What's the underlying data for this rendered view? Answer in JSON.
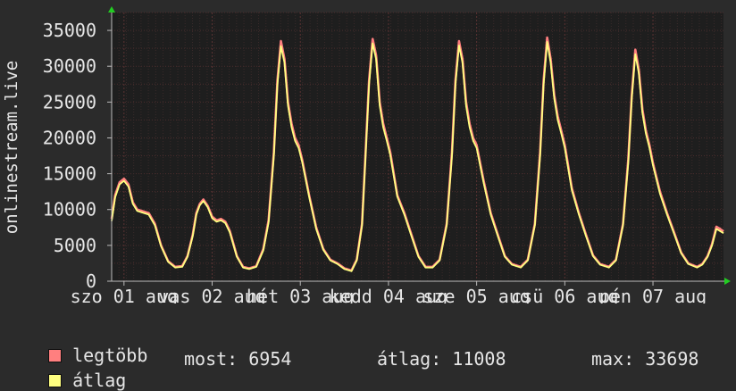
{
  "chart_data": {
    "type": "line",
    "ylabel": "onlinestream.live",
    "ylim": [
      0,
      37500
    ],
    "yticks": [
      "0",
      "5000",
      "10000",
      "15000",
      "20000",
      "25000",
      "30000",
      "35000"
    ],
    "ytick_values": [
      0,
      5000,
      10000,
      15000,
      20000,
      25000,
      30000,
      35000
    ],
    "xlim": [
      0,
      6.8
    ],
    "xticks": [
      "szo 01 aug",
      "vas 02 aug",
      "hét 03 aug",
      "kedd 04 aug",
      "sze 05 aug",
      "csü 06 aug",
      "pén 07 aug"
    ],
    "xtick_values": [
      0,
      1,
      2,
      3,
      4,
      5,
      6
    ],
    "grid": true,
    "legend_position": "bottom-left",
    "series": [
      {
        "name": "legtöbb",
        "color": "#ff7f7f",
        "x": [
          -0.14,
          -0.1,
          -0.05,
          0.0,
          0.05,
          0.1,
          0.15,
          0.2,
          0.28,
          0.35,
          0.42,
          0.5,
          0.58,
          0.66,
          0.72,
          0.78,
          0.82,
          0.86,
          0.9,
          0.95,
          1.0,
          1.05,
          1.1,
          1.15,
          1.2,
          1.28,
          1.35,
          1.42,
          1.5,
          1.58,
          1.64,
          1.7,
          1.74,
          1.78,
          1.82,
          1.86,
          1.9,
          1.94,
          1.98,
          2.02,
          2.1,
          2.18,
          2.26,
          2.34,
          2.42,
          2.5,
          2.58,
          2.64,
          2.7,
          2.74,
          2.78,
          2.82,
          2.86,
          2.9,
          2.94,
          2.98,
          3.02,
          3.1,
          3.18,
          3.26,
          3.34,
          3.42,
          3.5,
          3.58,
          3.66,
          3.72,
          3.76,
          3.8,
          3.84,
          3.88,
          3.92,
          3.96,
          4.0,
          4.08,
          4.16,
          4.24,
          4.32,
          4.4,
          4.5,
          4.58,
          4.66,
          4.72,
          4.76,
          4.8,
          4.84,
          4.88,
          4.92,
          4.96,
          5.0,
          5.08,
          5.16,
          5.24,
          5.32,
          5.4,
          5.5,
          5.58,
          5.66,
          5.72,
          5.76,
          5.8,
          5.84,
          5.88,
          5.92,
          5.96,
          6.0,
          6.08,
          6.16,
          6.24,
          6.32,
          6.4,
          6.5,
          6.56,
          6.62,
          6.67,
          6.72,
          6.76,
          6.8
        ],
        "y": [
          8700,
          12000,
          13800,
          14300,
          13500,
          11000,
          10000,
          9800,
          9500,
          8000,
          5000,
          2800,
          2000,
          2100,
          3500,
          6500,
          9500,
          10800,
          11400,
          10500,
          9000,
          8500,
          8700,
          8300,
          7000,
          3500,
          2000,
          1800,
          2100,
          4500,
          8500,
          18000,
          28000,
          33500,
          31000,
          25000,
          22000,
          20000,
          19000,
          17000,
          12000,
          7500,
          4500,
          3000,
          2500,
          1800,
          1500,
          3000,
          8000,
          18000,
          28000,
          33800,
          31500,
          25000,
          22000,
          20000,
          18000,
          12000,
          9500,
          6500,
          3500,
          2000,
          2000,
          3000,
          8000,
          18000,
          28000,
          33500,
          31000,
          25000,
          22000,
          20000,
          19000,
          14000,
          9500,
          6500,
          3500,
          2400,
          2000,
          3000,
          8000,
          18000,
          28000,
          34000,
          31000,
          26000,
          23000,
          21000,
          19000,
          13000,
          9500,
          6500,
          3600,
          2400,
          2000,
          3000,
          8000,
          17000,
          26000,
          32300,
          29500,
          24000,
          21000,
          19000,
          16500,
          12500,
          9500,
          6800,
          4000,
          2500,
          2000,
          2400,
          3500,
          5200,
          7600,
          7300,
          6954
        ]
      },
      {
        "name": "átlag",
        "color": "#ffff80",
        "x": [
          -0.14,
          -0.1,
          -0.05,
          0.0,
          0.05,
          0.1,
          0.15,
          0.2,
          0.28,
          0.35,
          0.42,
          0.5,
          0.58,
          0.66,
          0.72,
          0.78,
          0.82,
          0.86,
          0.9,
          0.95,
          1.0,
          1.05,
          1.1,
          1.15,
          1.2,
          1.28,
          1.35,
          1.42,
          1.5,
          1.58,
          1.64,
          1.7,
          1.74,
          1.78,
          1.82,
          1.86,
          1.9,
          1.94,
          1.98,
          2.02,
          2.1,
          2.18,
          2.26,
          2.34,
          2.42,
          2.5,
          2.58,
          2.64,
          2.7,
          2.74,
          2.78,
          2.82,
          2.86,
          2.9,
          2.94,
          2.98,
          3.02,
          3.1,
          3.18,
          3.26,
          3.34,
          3.42,
          3.5,
          3.58,
          3.66,
          3.72,
          3.76,
          3.8,
          3.84,
          3.88,
          3.92,
          3.96,
          4.0,
          4.08,
          4.16,
          4.24,
          4.32,
          4.4,
          4.5,
          4.58,
          4.66,
          4.72,
          4.76,
          4.8,
          4.84,
          4.88,
          4.92,
          4.96,
          5.0,
          5.08,
          5.16,
          5.24,
          5.32,
          5.4,
          5.5,
          5.58,
          5.66,
          5.72,
          5.76,
          5.8,
          5.84,
          5.88,
          5.92,
          5.96,
          6.0,
          6.08,
          6.16,
          6.24,
          6.32,
          6.4,
          6.5,
          6.56,
          6.62,
          6.67,
          6.72,
          6.76,
          6.8
        ],
        "y": [
          8400,
          11700,
          13500,
          14000,
          13200,
          10800,
          9800,
          9600,
          9300,
          7800,
          4900,
          2700,
          1900,
          2000,
          3400,
          6300,
          9300,
          10600,
          11200,
          10300,
          8800,
          8300,
          8500,
          8100,
          6800,
          3400,
          1900,
          1700,
          2000,
          4300,
          8200,
          17500,
          27500,
          32800,
          30500,
          24500,
          21500,
          19600,
          18600,
          16700,
          11800,
          7300,
          4400,
          2900,
          2400,
          1700,
          1400,
          2900,
          7800,
          17500,
          27500,
          33200,
          31000,
          24500,
          21500,
          19600,
          17600,
          11800,
          9300,
          6300,
          3400,
          1900,
          1900,
          2900,
          7800,
          17500,
          27500,
          32900,
          30500,
          24500,
          21500,
          19600,
          18600,
          13700,
          9300,
          6300,
          3400,
          2300,
          1900,
          2900,
          7800,
          17500,
          27500,
          33400,
          30500,
          25500,
          22500,
          20600,
          18600,
          12700,
          9300,
          6300,
          3500,
          2300,
          1900,
          2900,
          7800,
          16600,
          25500,
          31700,
          29000,
          23500,
          20600,
          18600,
          16200,
          12200,
          9300,
          6600,
          3900,
          2400,
          1900,
          2300,
          3400,
          5000,
          7300,
          7000,
          6700
        ]
      }
    ]
  },
  "legend": {
    "max_label": "legtöbb",
    "avg_label": "átlag",
    "max_color": "#ff7f7f",
    "avg_color": "#ffff80"
  },
  "stats": {
    "current": "most: 6954",
    "average": "átlag: 11008",
    "maximum": "max: 33698"
  }
}
